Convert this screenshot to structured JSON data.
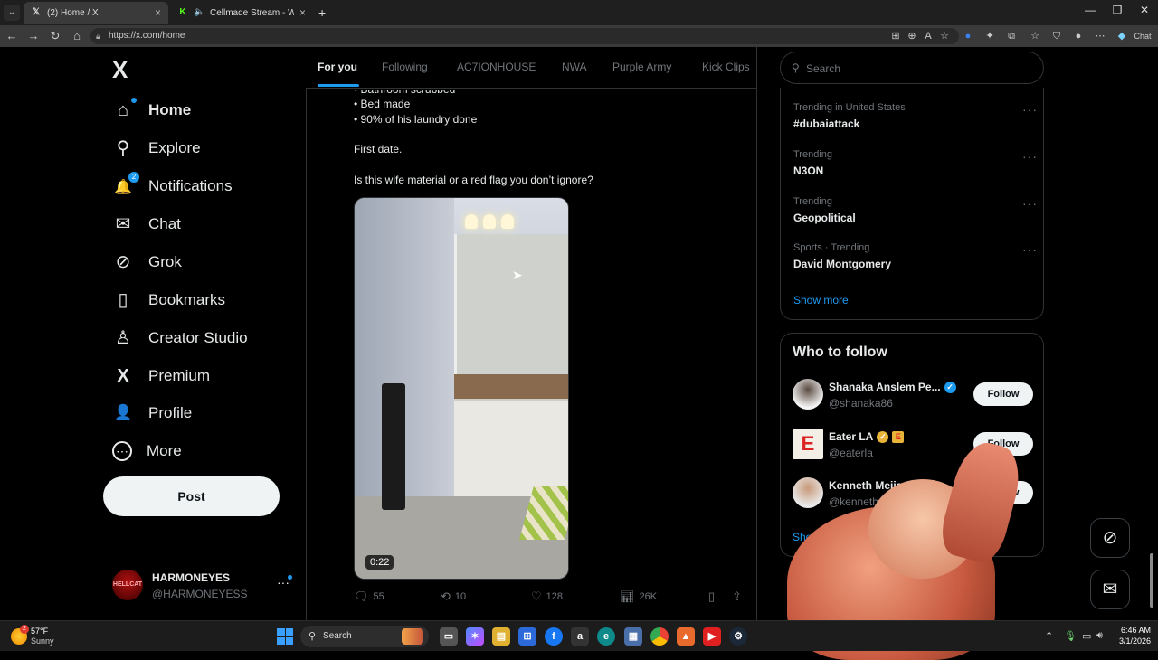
{
  "browser": {
    "tabs": [
      {
        "title": "(2) Home / X",
        "favicon": "x-logo"
      },
      {
        "title": "Cellmade Stream - Watch Liv",
        "favicon": "kick-logo"
      }
    ],
    "new_tab": "+",
    "url": "https://x.com/home",
    "chat_label": "Chat",
    "window_controls": {
      "minimize": "—",
      "restore": "❐",
      "close": "✕"
    }
  },
  "sidebar": {
    "logo": "X",
    "nav": [
      {
        "label": "Home",
        "icon": "home-icon",
        "glyph": "⌂",
        "active": true
      },
      {
        "label": "Explore",
        "icon": "search-icon",
        "glyph": "⚲"
      },
      {
        "label": "Notifications",
        "icon": "bell-icon",
        "glyph": "🔔",
        "badge": "2"
      },
      {
        "label": "Chat",
        "icon": "mail-icon",
        "glyph": "✉"
      },
      {
        "label": "Grok",
        "icon": "grok-icon",
        "glyph": "⊘"
      },
      {
        "label": "Bookmarks",
        "icon": "bookmark-icon",
        "glyph": "▯"
      },
      {
        "label": "Creator Studio",
        "icon": "creator-studio-icon",
        "glyph": "♙"
      },
      {
        "label": "Premium",
        "icon": "x-premium-icon",
        "glyph": "X"
      },
      {
        "label": "Profile",
        "icon": "profile-icon",
        "glyph": "👤"
      },
      {
        "label": "More",
        "icon": "more-icon",
        "glyph": "⋯"
      }
    ],
    "post_button": "Post",
    "account": {
      "name": "HARMONEYES",
      "handle": "@HARMONEYESS",
      "more": "···"
    }
  },
  "feed": {
    "tabs": [
      "For you",
      "Following",
      "AC7IONHOUSE",
      "NWA",
      "Purple Army",
      "Kick Clips"
    ],
    "post": {
      "lines": [
        "• Bathroom scrubbed",
        "• Bed made",
        "• 90% of his laundry done"
      ],
      "line2": "First date.",
      "line3": "Is this wife material or a red flag you don’t ignore?",
      "video_duration": "0:22",
      "actions": {
        "replies": "55",
        "reposts": "10",
        "likes": "128",
        "views": "26K"
      }
    }
  },
  "right": {
    "search_placeholder": "Search",
    "trends": [
      {
        "context": "Trending in United States",
        "name": "#dubaiattack"
      },
      {
        "context": "Trending",
        "name": "N3ON"
      },
      {
        "context": "Trending",
        "name": "Geopolitical"
      },
      {
        "context": "Sports · Trending",
        "name": "David Montgomery"
      }
    ],
    "show_more": "Show more",
    "who_to_follow": {
      "title": "Who to follow",
      "accounts": [
        {
          "name": "Shanaka Anslem Pe...",
          "handle": "@shanaka86",
          "badge": "verified-blue"
        },
        {
          "name": "Eater LA",
          "handle": "@eaterla",
          "badge": "verified-gold"
        },
        {
          "name": "Kenneth Mejia, CPA",
          "handle": "@kenneth",
          "badge": ""
        }
      ],
      "follow_label": "Follow",
      "show_more": "Show more"
    }
  },
  "taskbar": {
    "weather": {
      "temp": "57°F",
      "condition": "Sunny",
      "badge": "2"
    },
    "search_label": "Search",
    "time": "6:46 AM",
    "date": "3/1/2026"
  },
  "colors": {
    "accent": "#1d9bf0",
    "background": "#000000",
    "text": "#e7e9ea",
    "muted": "#71767b"
  }
}
